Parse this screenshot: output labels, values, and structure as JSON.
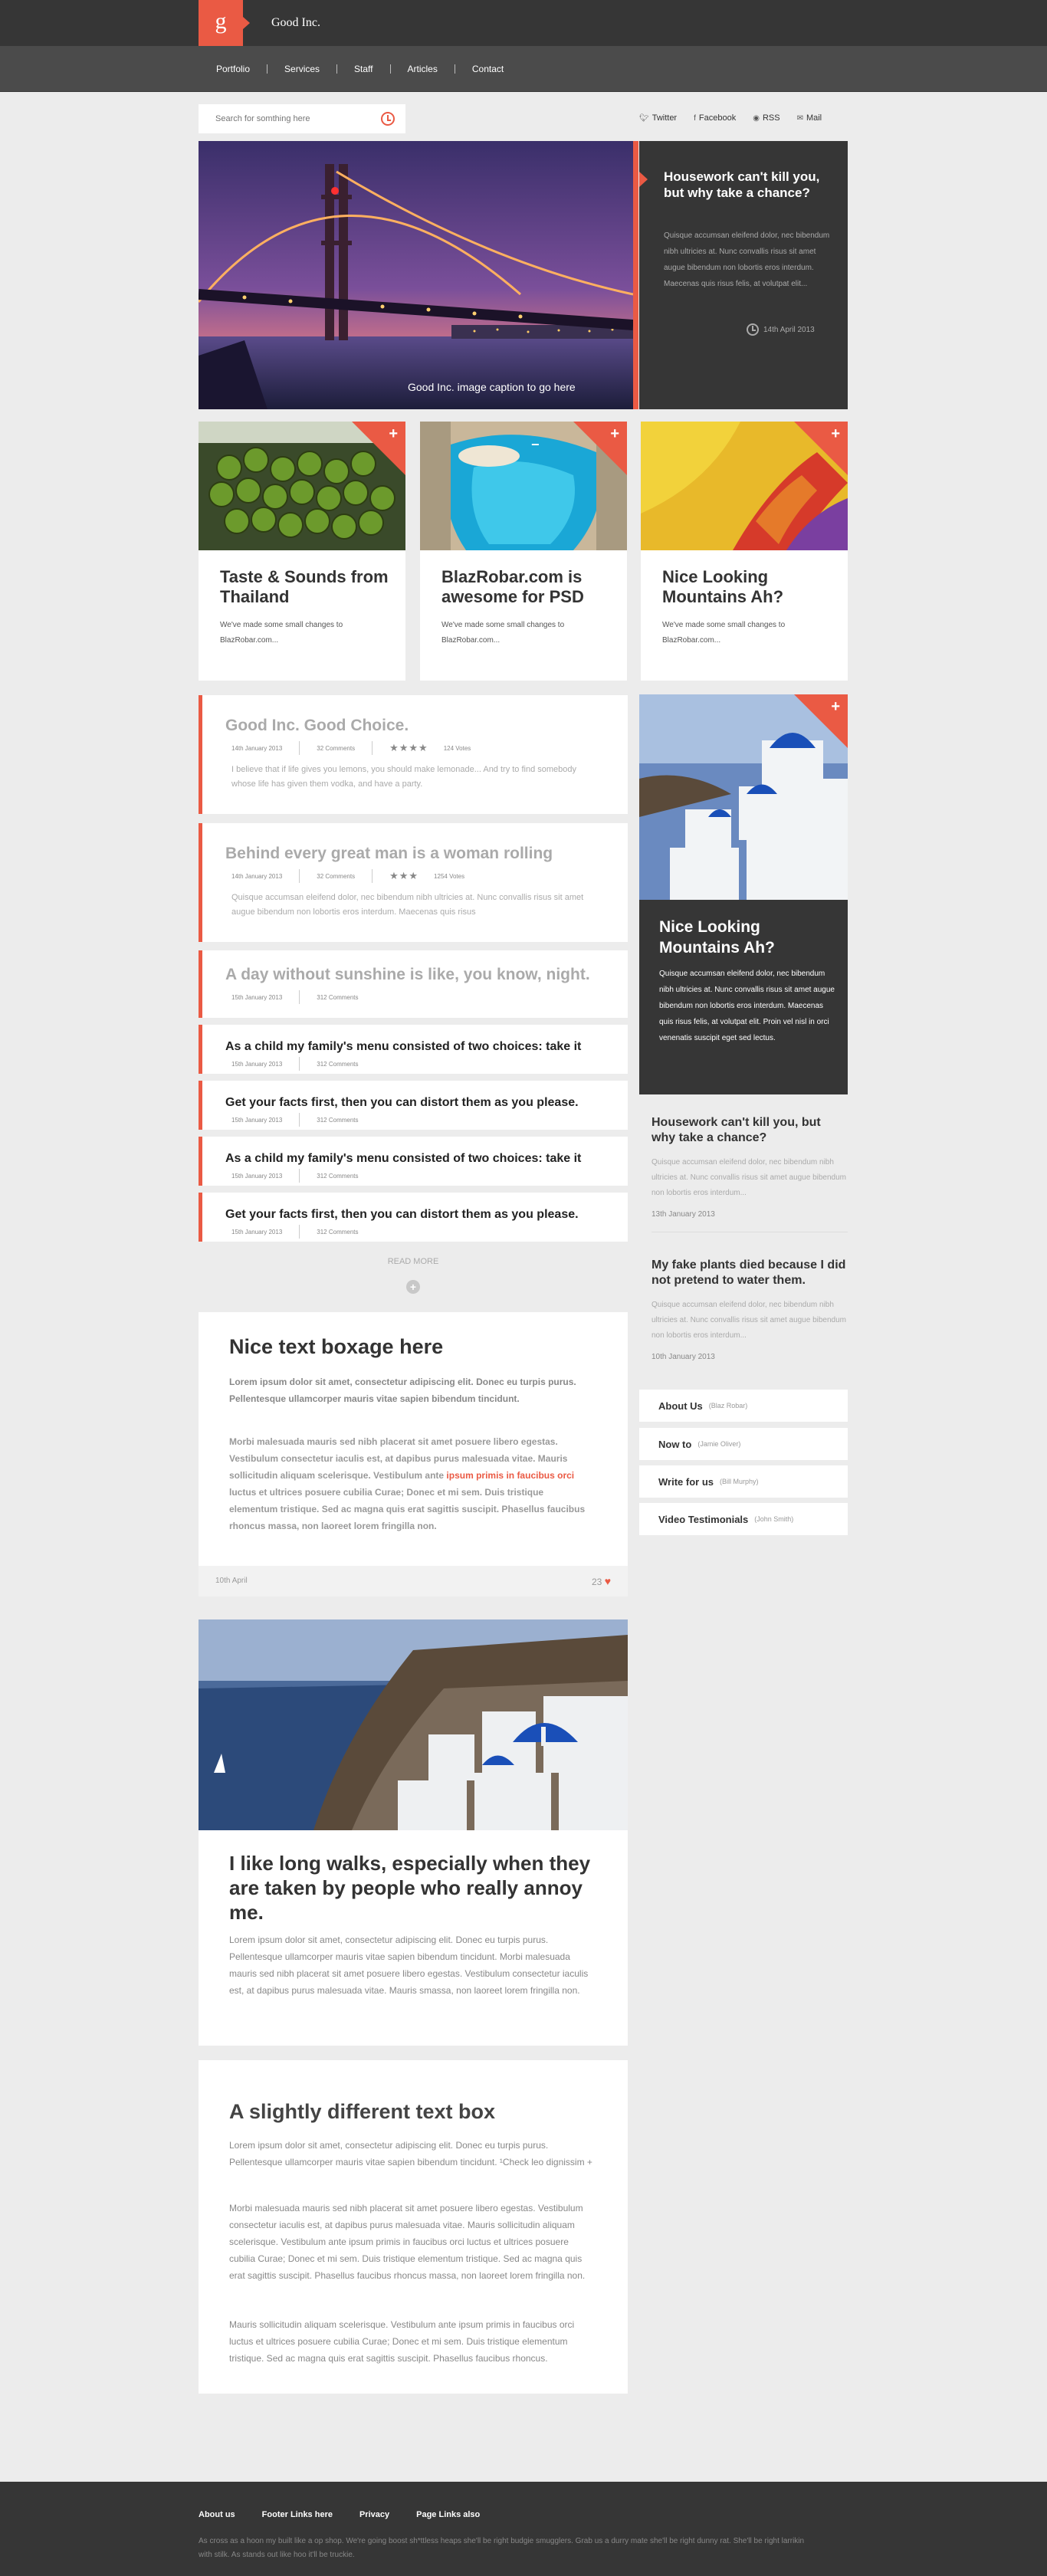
{
  "brand": {
    "logo_letter": "g",
    "name": "Good Inc."
  },
  "nav": [
    "Portfolio",
    "Services",
    "Staff",
    "Articles",
    "Contact"
  ],
  "search": {
    "placeholder": "Search for somthing here"
  },
  "social": [
    {
      "icon": "twitter-icon",
      "label": "Twitter"
    },
    {
      "icon": "facebook-icon",
      "label": "Facebook"
    },
    {
      "icon": "rss-icon",
      "label": "RSS"
    },
    {
      "icon": "mail-icon",
      "label": "Mail"
    }
  ],
  "hero": {
    "caption": "Good Inc. image caption to go here",
    "title": "Housework can't kill you, but why take a chance?",
    "text": "Quisque accumsan eleifend dolor, nec bibendum nibh ultricies at. Nunc convallis risus sit amet augue bibendum non lobortis eros interdum. Maecenas quis risus felis, at volutpat elit...",
    "date": "14th April 2013"
  },
  "cards": [
    {
      "title": "Taste & Sounds from Thailand",
      "text": "We've made some small changes to BlazRobar.com..."
    },
    {
      "title": "BlazRobar.com is awesome for PSD",
      "text": "We've made some small changes to BlazRobar.com..."
    },
    {
      "title": "Nice Looking Mountains Ah?",
      "text": "We've made some small changes to BlazRobar.com..."
    }
  ],
  "posts": [
    {
      "title": "Good Inc. Good Choice.",
      "date": "14th January 2013",
      "comments": "32 Comments",
      "stars": "★★★★",
      "votes": "124 Votes",
      "excerpt": "I believe that if life gives you lemons, you should make lemonade... And try to find somebody whose life has given them vodka, and have a party."
    },
    {
      "title": "Behind every great man is a woman rolling",
      "date": "14th January 2013",
      "comments": "32 Comments",
      "stars": "★★★",
      "votes": "1254 Votes",
      "excerpt": "Quisque accumsan eleifend dolor, nec bibendum nibh ultricies at. Nunc convallis risus sit amet augue bibendum non lobortis eros interdum. Maecenas quis risus"
    },
    {
      "title": "A day without sunshine is like, you know, night.",
      "date": "15th January 2013",
      "comments": "312 Comments"
    },
    {
      "title": "As a child my family's menu consisted of two choices: take it",
      "date": "15th January 2013",
      "comments": "312 Comments"
    },
    {
      "title": "Get your facts first, then you can distort them as you please.",
      "date": "15th January 2013",
      "comments": "312 Comments"
    },
    {
      "title": "As a child my family's menu consisted of two choices: take it",
      "date": "15th January 2013",
      "comments": "312 Comments"
    },
    {
      "title": "Get your facts first, then you can distort them as you please.",
      "date": "15th January 2013",
      "comments": "312 Comments"
    }
  ],
  "read_more": "READ MORE",
  "bigtext": {
    "title": "Nice text boxage here",
    "lead": "Lorem ipsum dolor sit amet, consectetur adipiscing elit. Donec eu turpis purus. Pellentesque ullamcorper mauris vitae sapien bibendum tincidunt.",
    "body_a": "Morbi malesuada mauris sed nibh placerat sit amet posuere libero egestas. Vestibulum consectetur iaculis est, at dapibus purus malesuada vitae. Mauris sollicitudin aliquam scelerisque. Vestibulum ante ",
    "body_link": "ipsum primis in faucibus orci",
    "body_b": " luctus et ultrices posuere cubilia Curae; Donec et mi sem. Duis tristique elementum tristique. Sed ac magna quis erat sagittis suscipit. Phasellus faucibus rhoncus massa, non laoreet lorem fringilla non.",
    "date": "10th April",
    "likes": "23"
  },
  "walk": {
    "title": "I like long walks, especially when they are taken by people who really annoy me.",
    "text": "Lorem ipsum dolor sit amet, consectetur adipiscing elit. Donec eu turpis purus. Pellentesque ullamcorper mauris vitae sapien bibendum tincidunt. Morbi malesuada mauris sed nibh placerat sit amet posuere libero egestas. Vestibulum consectetur iaculis est, at dapibus purus malesuada vitae. Mauris smassa, non laoreet lorem fringilla non."
  },
  "diff": {
    "title": "A slightly different text box",
    "p1": "Lorem ipsum dolor sit amet, consectetur adipiscing elit. Donec eu turpis purus. Pellentesque ullamcorper mauris vitae sapien bibendum tincidunt. ¹Check leo dignissim +",
    "p2": "Morbi malesuada mauris sed nibh placerat sit amet posuere libero egestas. Vestibulum consectetur iaculis est, at dapibus purus malesuada vitae. Mauris sollicitudin aliquam scelerisque. Vestibulum ante ipsum primis in faucibus orci luctus et ultrices posuere cubilia Curae; Donec et mi sem. Duis tristique elementum tristique. Sed ac magna quis erat sagittis suscipit. Phasellus faucibus rhoncus massa, non laoreet lorem fringilla non.",
    "p3": "Mauris sollicitudin aliquam scelerisque. Vestibulum ante ipsum primis in faucibus orci luctus et ultrices posuere cubilia Curae; Donec et mi sem. Duis tristique elementum tristique. Sed ac magna quis erat sagittis suscipit. Phasellus faucibus rhoncus."
  },
  "sidebar": {
    "feature": {
      "title": "Nice Looking Mountains Ah?",
      "text": "Quisque accumsan eleifend dolor, nec bibendum nibh ultricies at. Nunc convallis risus sit amet augue bibendum non lobortis eros interdum. Maecenas quis risus felis, at volutpat elit. Proin vel nisl in orci venenatis suscipit eget sed lectus."
    },
    "posts": [
      {
        "title": "Housework can't kill you, but why take a chance?",
        "text": "Quisque accumsan eleifend dolor, nec bibendum nibh ultricies at. Nunc convallis risus sit amet augue bibendum non lobortis eros interdum...",
        "date": "13th January 2013"
      },
      {
        "title": "My fake plants died because I did not pretend to water them.",
        "text": "Quisque accumsan eleifend dolor, nec bibendum nibh ultricies at. Nunc convallis risus sit amet augue bibendum non lobortis eros interdum...",
        "date": "10th January 2013"
      }
    ],
    "links": [
      {
        "label": "About Us",
        "who": "(Blaz Robar)"
      },
      {
        "label": "Now to",
        "who": "(Jamie Oliver)"
      },
      {
        "label": "Write for us",
        "who": "(Bill Murphy)"
      },
      {
        "label": "Video Testimonials",
        "who": "(John Smith)"
      }
    ]
  },
  "footer": {
    "links": [
      "About us",
      "Footer Links here",
      "Privacy",
      "Page Links also"
    ],
    "text": "As cross as a hoon my built like a op shop. We're going boost sh*ttless heaps she'll be right budgie smugglers. Grab us a durry mate she'll be right dunny rat. She'll be right larrikin with stilk. As stands out like hoo it'll be truckie."
  },
  "colors": {
    "accent": "#ea5a44",
    "dark": "#363636"
  }
}
